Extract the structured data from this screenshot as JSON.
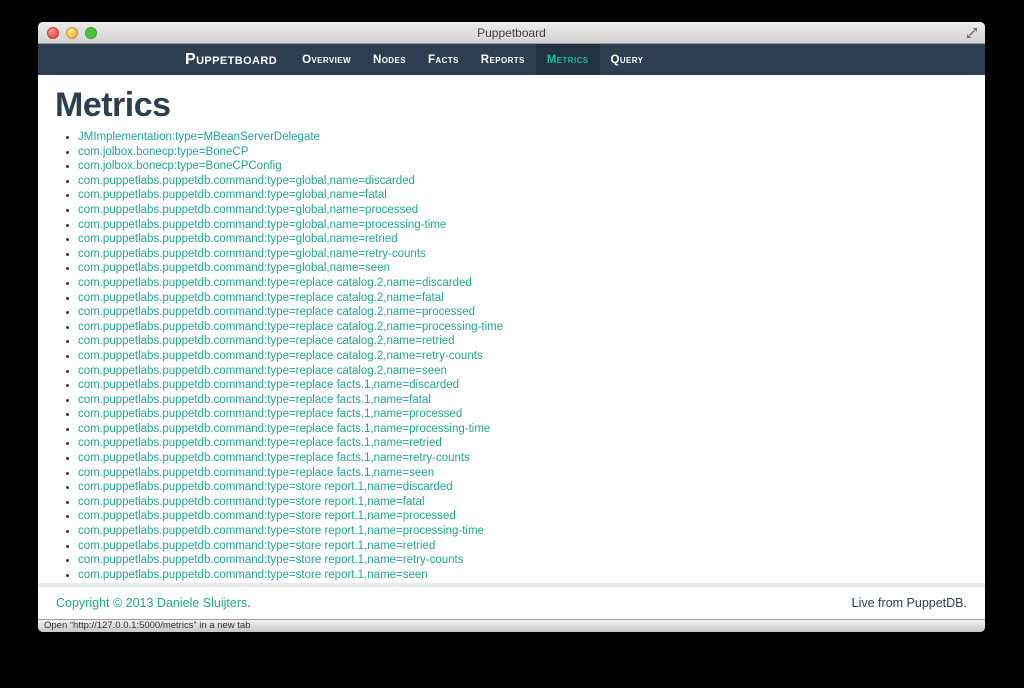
{
  "window": {
    "title": "Puppetboard",
    "status_text": "Open “http://127.0.0.1:5000/metrics” in a new tab"
  },
  "navbar": {
    "brand": "Puppetboard",
    "items": [
      {
        "label": "Overview",
        "active": false
      },
      {
        "label": "Nodes",
        "active": false
      },
      {
        "label": "Facts",
        "active": false
      },
      {
        "label": "Reports",
        "active": false
      },
      {
        "label": "Metrics",
        "active": true
      },
      {
        "label": "Query",
        "active": false
      }
    ]
  },
  "main": {
    "heading": "Metrics",
    "metrics": [
      "JMImplementation:type=MBeanServerDelegate",
      "com.jolbox.bonecp:type=BoneCP",
      "com.jolbox.bonecp:type=BoneCPConfig",
      "com.puppetlabs.puppetdb.command:type=global,name=discarded",
      "com.puppetlabs.puppetdb.command:type=global,name=fatal",
      "com.puppetlabs.puppetdb.command:type=global,name=processed",
      "com.puppetlabs.puppetdb.command:type=global,name=processing-time",
      "com.puppetlabs.puppetdb.command:type=global,name=retried",
      "com.puppetlabs.puppetdb.command:type=global,name=retry-counts",
      "com.puppetlabs.puppetdb.command:type=global,name=seen",
      "com.puppetlabs.puppetdb.command:type=replace catalog.2,name=discarded",
      "com.puppetlabs.puppetdb.command:type=replace catalog.2,name=fatal",
      "com.puppetlabs.puppetdb.command:type=replace catalog.2,name=processed",
      "com.puppetlabs.puppetdb.command:type=replace catalog.2,name=processing-time",
      "com.puppetlabs.puppetdb.command:type=replace catalog.2,name=retried",
      "com.puppetlabs.puppetdb.command:type=replace catalog.2,name=retry-counts",
      "com.puppetlabs.puppetdb.command:type=replace catalog.2,name=seen",
      "com.puppetlabs.puppetdb.command:type=replace facts.1,name=discarded",
      "com.puppetlabs.puppetdb.command:type=replace facts.1,name=fatal",
      "com.puppetlabs.puppetdb.command:type=replace facts.1,name=processed",
      "com.puppetlabs.puppetdb.command:type=replace facts.1,name=processing-time",
      "com.puppetlabs.puppetdb.command:type=replace facts.1,name=retried",
      "com.puppetlabs.puppetdb.command:type=replace facts.1,name=retry-counts",
      "com.puppetlabs.puppetdb.command:type=replace facts.1,name=seen",
      "com.puppetlabs.puppetdb.command:type=store report.1,name=discarded",
      "com.puppetlabs.puppetdb.command:type=store report.1,name=fatal",
      "com.puppetlabs.puppetdb.command:type=store report.1,name=processed",
      "com.puppetlabs.puppetdb.command:type=store report.1,name=processing-time",
      "com.puppetlabs.puppetdb.command:type=store report.1,name=retried",
      "com.puppetlabs.puppetdb.command:type=store report.1,name=retry-counts",
      "com.puppetlabs.puppetdb.command:type=store report.1,name=seen"
    ]
  },
  "footer": {
    "copyright_link": "Copyright © 2013 Daniele Sluijters",
    "copyright_period": ".",
    "live_text": "Live from PuppetDB."
  },
  "colors": {
    "navbar_bg": "#2c3e50",
    "navbar_active_bg": "#233240",
    "teal": "#1abc9c",
    "link": "#21a78d",
    "dark": "#2c3e50"
  }
}
